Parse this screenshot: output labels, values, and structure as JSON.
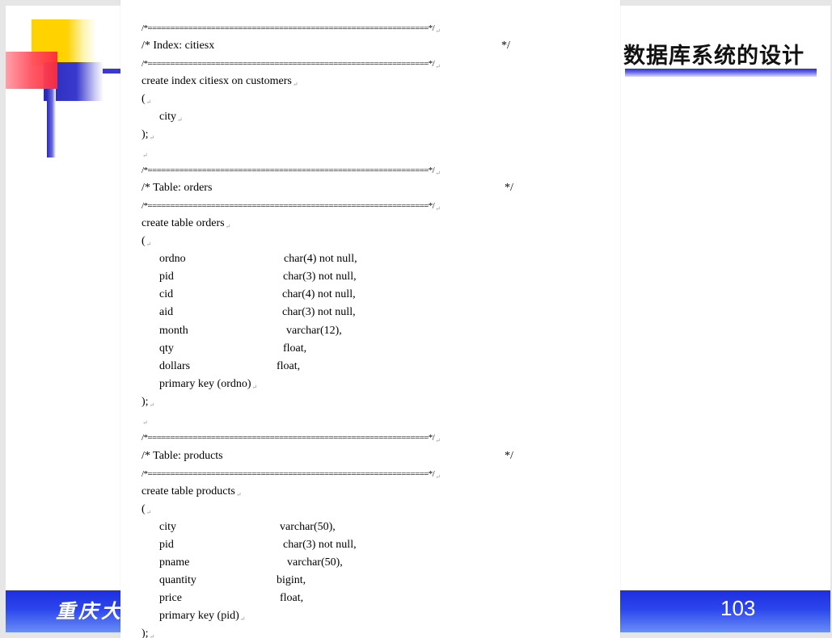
{
  "slide": {
    "title": "数据库系统的设计",
    "footer_text": "重庆大学",
    "page_number": "103"
  },
  "doc": {
    "sep": "/*==============================================================*/",
    "para_mark": "↵",
    "index_header": "/* Index: citiesx",
    "index_header_end": "*/",
    "create_index": "create index citiesx on customers",
    "open_paren": "(",
    "index_col": "city",
    "close": ");",
    "orders_header": "/* Table: orders",
    "orders_header_end": "*/",
    "create_orders": "create table orders",
    "orders_cols": [
      {
        "name": "ordno",
        "type": "char(4) not null,"
      },
      {
        "name": "pid",
        "type": "char(3) not null,"
      },
      {
        "name": "cid",
        "type": "char(4) not null,"
      },
      {
        "name": "aid",
        "type": "char(3) not null,"
      },
      {
        "name": "month",
        "type": "varchar(12),"
      },
      {
        "name": "qty",
        "type": "float,"
      },
      {
        "name": "dollars",
        "type": "float,"
      }
    ],
    "orders_pk": "primary key (ordno)",
    "products_header": "/* Table: products",
    "products_header_end": "*/",
    "create_products": "create table products",
    "products_cols": [
      {
        "name": "city",
        "type": "varchar(50),"
      },
      {
        "name": "pid",
        "type": "char(3) not null,"
      },
      {
        "name": "pname",
        "type": "varchar(50),"
      },
      {
        "name": "quantity",
        "type": "bigint,"
      },
      {
        "name": "price",
        "type": "float,"
      }
    ],
    "products_pk": "primary key (pid)"
  }
}
